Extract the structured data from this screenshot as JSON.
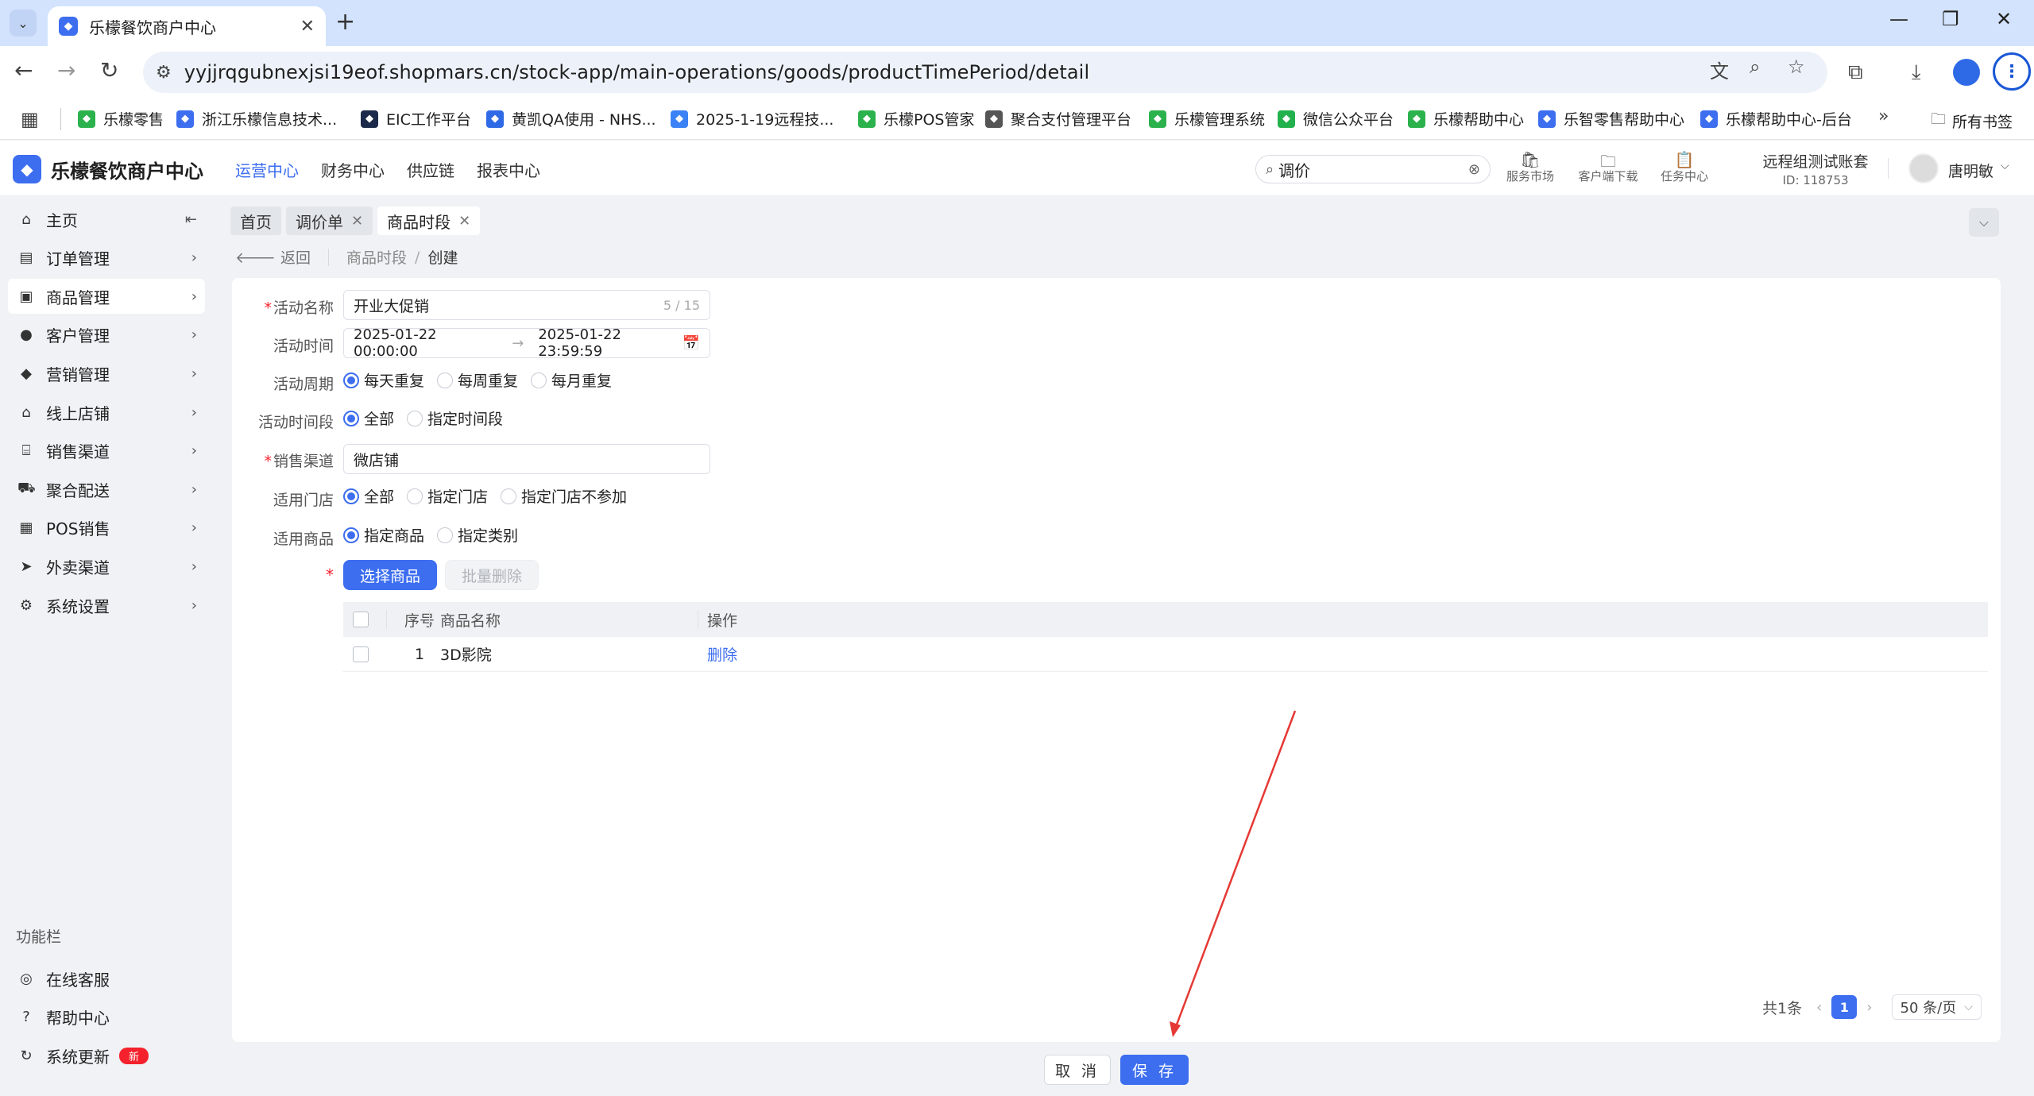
{
  "browser": {
    "tab_title": "乐檬餐饮商户中心",
    "url": "yyjjrqgubnexjsi19eof.shopmars.cn/stock-app/main-operations/goods/productTimePeriod/detail",
    "bookmarks": [
      {
        "label": "乐檬零售",
        "color": "#2bb24c"
      },
      {
        "label": "浙江乐檬信息技术...",
        "color": "#3d6ef0"
      },
      {
        "label": "EIC工作平台",
        "color": "#1b2a4a"
      },
      {
        "label": "黄凯QA使用 - NHS...",
        "color": "#2f6ae6"
      },
      {
        "label": "2025-1-19远程技...",
        "color": "#3b82f6"
      },
      {
        "label": "乐檬POS管家",
        "color": "#2bb24c"
      },
      {
        "label": "聚合支付管理平台",
        "color": "#555555"
      },
      {
        "label": "乐檬管理系统",
        "color": "#2bb24c"
      },
      {
        "label": "微信公众平台",
        "color": "#22b14c"
      },
      {
        "label": "乐檬帮助中心",
        "color": "#2bb24c"
      },
      {
        "label": "乐智零售帮助中心",
        "color": "#3d6ef0"
      },
      {
        "label": "乐檬帮助中心-后台",
        "color": "#3d6ef0"
      }
    ],
    "all_bookmarks": "所有书签"
  },
  "header": {
    "logo": "乐檬餐饮商户中心",
    "nav": [
      "运营中心",
      "财务中心",
      "供应链",
      "报表中心"
    ],
    "search_value": "调价",
    "tools": [
      "服务市场",
      "客户端下载",
      "任务中心"
    ],
    "account_name": "远程组测试账套",
    "account_id": "ID: 118753",
    "user_name": "唐明敏"
  },
  "sidebar": {
    "items": [
      {
        "label": "主页",
        "icon": "home-icon"
      },
      {
        "label": "订单管理",
        "icon": "order-icon"
      },
      {
        "label": "商品管理",
        "icon": "goods-icon"
      },
      {
        "label": "客户管理",
        "icon": "user-icon"
      },
      {
        "label": "营销管理",
        "icon": "tag-icon"
      },
      {
        "label": "线上店铺",
        "icon": "shop-icon"
      },
      {
        "label": "销售渠道",
        "icon": "bank-icon"
      },
      {
        "label": "聚合配送",
        "icon": "truck-icon"
      },
      {
        "label": "POS销售",
        "icon": "store-icon"
      },
      {
        "label": "外卖渠道",
        "icon": "delivery-icon"
      },
      {
        "label": "系统设置",
        "icon": "gear-icon"
      }
    ],
    "section_title": "功能栏",
    "extras": [
      {
        "label": "在线客服",
        "icon": "service-icon"
      },
      {
        "label": "帮助中心",
        "icon": "help-icon"
      },
      {
        "label": "系统更新",
        "icon": "refresh-icon",
        "badge": "新"
      }
    ]
  },
  "page_tabs": [
    "首页",
    "调价单",
    "商品时段"
  ],
  "breadcrumb": {
    "back": "返回",
    "parent": "商品时段",
    "current": "创建"
  },
  "form": {
    "name_label": "活动名称",
    "name_value": "开业大促销",
    "name_counter": "5 / 15",
    "time_label": "活动时间",
    "time_start": "2025-01-22 00:00:00",
    "time_end": "2025-01-22 23:59:59",
    "cycle_label": "活动周期",
    "cycle_options": [
      "每天重复",
      "每周重复",
      "每月重复"
    ],
    "period_label": "活动时间段",
    "period_options": [
      "全部",
      "指定时间段"
    ],
    "channel_label": "销售渠道",
    "channel_value": "微店铺",
    "store_label": "适用门店",
    "store_options": [
      "全部",
      "指定门店",
      "指定门店不参加"
    ],
    "goods_label": "适用商品",
    "goods_options": [
      "指定商品",
      "指定类别"
    ],
    "select_goods_btn": "选择商品",
    "batch_delete_btn": "批量删除"
  },
  "table": {
    "headers": [
      "序号",
      "商品名称",
      "操作"
    ],
    "rows": [
      {
        "index": "1",
        "name": "3D影院",
        "action": "删除"
      }
    ]
  },
  "pagination": {
    "total": "共1条",
    "page": "1",
    "page_size": "50 条/页"
  },
  "footer": {
    "cancel": "取 消",
    "save": "保 存"
  },
  "colors": {
    "primary": "#3d6ef0",
    "annotation_arrow": "#e53935"
  }
}
